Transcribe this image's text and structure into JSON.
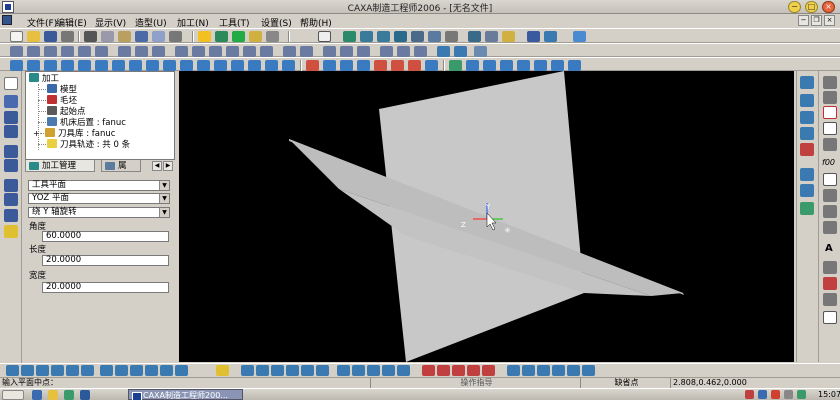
{
  "window": {
    "title": "CAXA制造工程师2006 - [无名文件]",
    "controls": [
      "−",
      "□",
      "×"
    ]
  },
  "menu": {
    "items": [
      "文件(F)",
      "编辑(E)",
      "显示(V)",
      "造型(U)",
      "加工(N)",
      "工具(T)",
      "设置(S)",
      "帮助(H)"
    ],
    "mdi_controls": [
      "−",
      "❐",
      "×"
    ]
  },
  "tree": {
    "root": "加工",
    "children": [
      "模型",
      "毛坯",
      "起始点",
      "机床后置 : fanuc",
      "刀具库 : fanuc",
      "刀具轨迹 : 共 0 条"
    ]
  },
  "tabs": {
    "items": [
      "加工管理",
      "属"
    ],
    "active": 0,
    "arrows": [
      "◀",
      "▶"
    ]
  },
  "properties": {
    "plane_type": "工具平面",
    "plane": "YOZ 平面",
    "rotation": "绕 Y 轴旋转",
    "angle_label": "角度",
    "angle_value": "60.0000",
    "length_label": "长度",
    "length_value": "20.0000",
    "width_label": "宽度",
    "width_value": "20.0000",
    "combo_arrow": "▼"
  },
  "viewport": {
    "background": "#000000",
    "plane_color": "#c8c8c8",
    "axis_labels": {
      "x": "X",
      "y": "Y",
      "z": "Z"
    }
  },
  "status": {
    "prompt": "输入平面中点：",
    "hint": "操作指导",
    "snap": "缺省点",
    "coordinates": "2.808,0.462,0.000"
  },
  "taskbar": {
    "active_app": "CAXA制造工程师200...",
    "clock": "15:07"
  },
  "right_strip": {
    "text_labels": [
      "f00",
      "A"
    ]
  }
}
